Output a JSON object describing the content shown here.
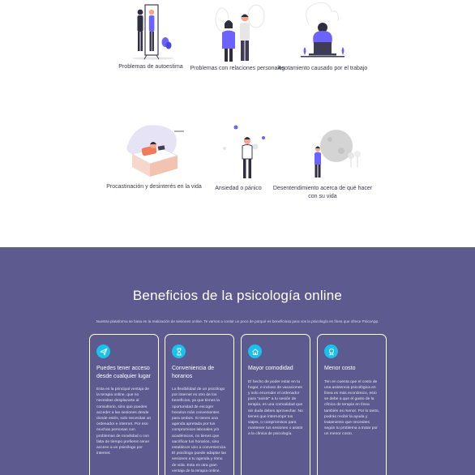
{
  "problems": [
    {
      "label": "Problemas de autoestima",
      "icon": "mirror-illustration-icon"
    },
    {
      "label": "Problemas con relaciones personales",
      "icon": "couple-illustration-icon"
    },
    {
      "label": "Agotamiento causado por el trabajo",
      "icon": "burnout-laptop-illustration-icon"
    },
    {
      "label": "Procastinación y desinterés en la vida",
      "icon": "bed-illustration-icon"
    },
    {
      "label": "Ansiedad o pánico",
      "icon": "anxiety-illustration-icon"
    },
    {
      "label": "Desentendimiento acerca de qué hacer con su vida",
      "icon": "moon-illustration-icon"
    }
  ],
  "benefits": {
    "title": "Beneficios de la psicología online",
    "intro": "Nuestra plataforma se basa en la realización de sesiones online. Te vamos a contar un poco de porqué es beneficiosa para vos la psicología en línea que ofrece PsicoApp.",
    "cards": [
      {
        "icon": "paper-plane-icon",
        "title": "Puedes tener acceso desde cualquier lugar",
        "text": "Esta es la principal ventaja de la terapia online, que no necesitas desplazarte al consultorio, sino que puedes acceder a las sesiones desde donde estés, solo necesitas un ordenador e internet. Por eso muchas personas con problemas de movilidad o con falta de tiempo prefieren tener acceso a un psicólogo por internet."
      },
      {
        "icon": "hourglass-icon",
        "title": "Conveniencia de horarios",
        "text": "La flexibilidad de un psicólogo por internet es otro de los beneficios, ya que tienes la oportunidad de escoger horarios más convenientes para ambos. Si tienes una agenda apretada por tus compromisos laborales y/o académicos, no tienes que sacrificar tus horarios, sino establecer uno a conveniencia. El psicólogo puede adaptar las sesiones a tu agenda y ritmo de vida. Esta es otra gran ventaja de la terapia online."
      },
      {
        "icon": "home-icon",
        "title": "Mayor comodidad",
        "text": "El hecho de poder estar en tu hogar, e incluso de vacaciones y solo encender el ordenador para \"asistir\" a tu sesión de terapia, es una comodidad que sin duda debes aprovechar. No tienes que interrumpir tus viajes, o compromisos para mantener tus sesiones o asistir a la clínica de psicología."
      },
      {
        "icon": "coin-icon",
        "title": "Menor costo",
        "text": "Ten en cuenta que el costo de una asistencia psicológica en línea es más económico, esto se debe a que el gasto de la clínica de terapia en línea también es menor. Por lo tanto, podrás recibir la ayuda y tratamiento que necesites según tu problema a tratar por un menor costo."
      }
    ]
  },
  "colors": {
    "accent": "#6c63ff",
    "section_bg": "#5c5a8e",
    "icon_badge": "#19c1ec",
    "skin": "#f4a58a",
    "dark": "#2f2e41"
  }
}
